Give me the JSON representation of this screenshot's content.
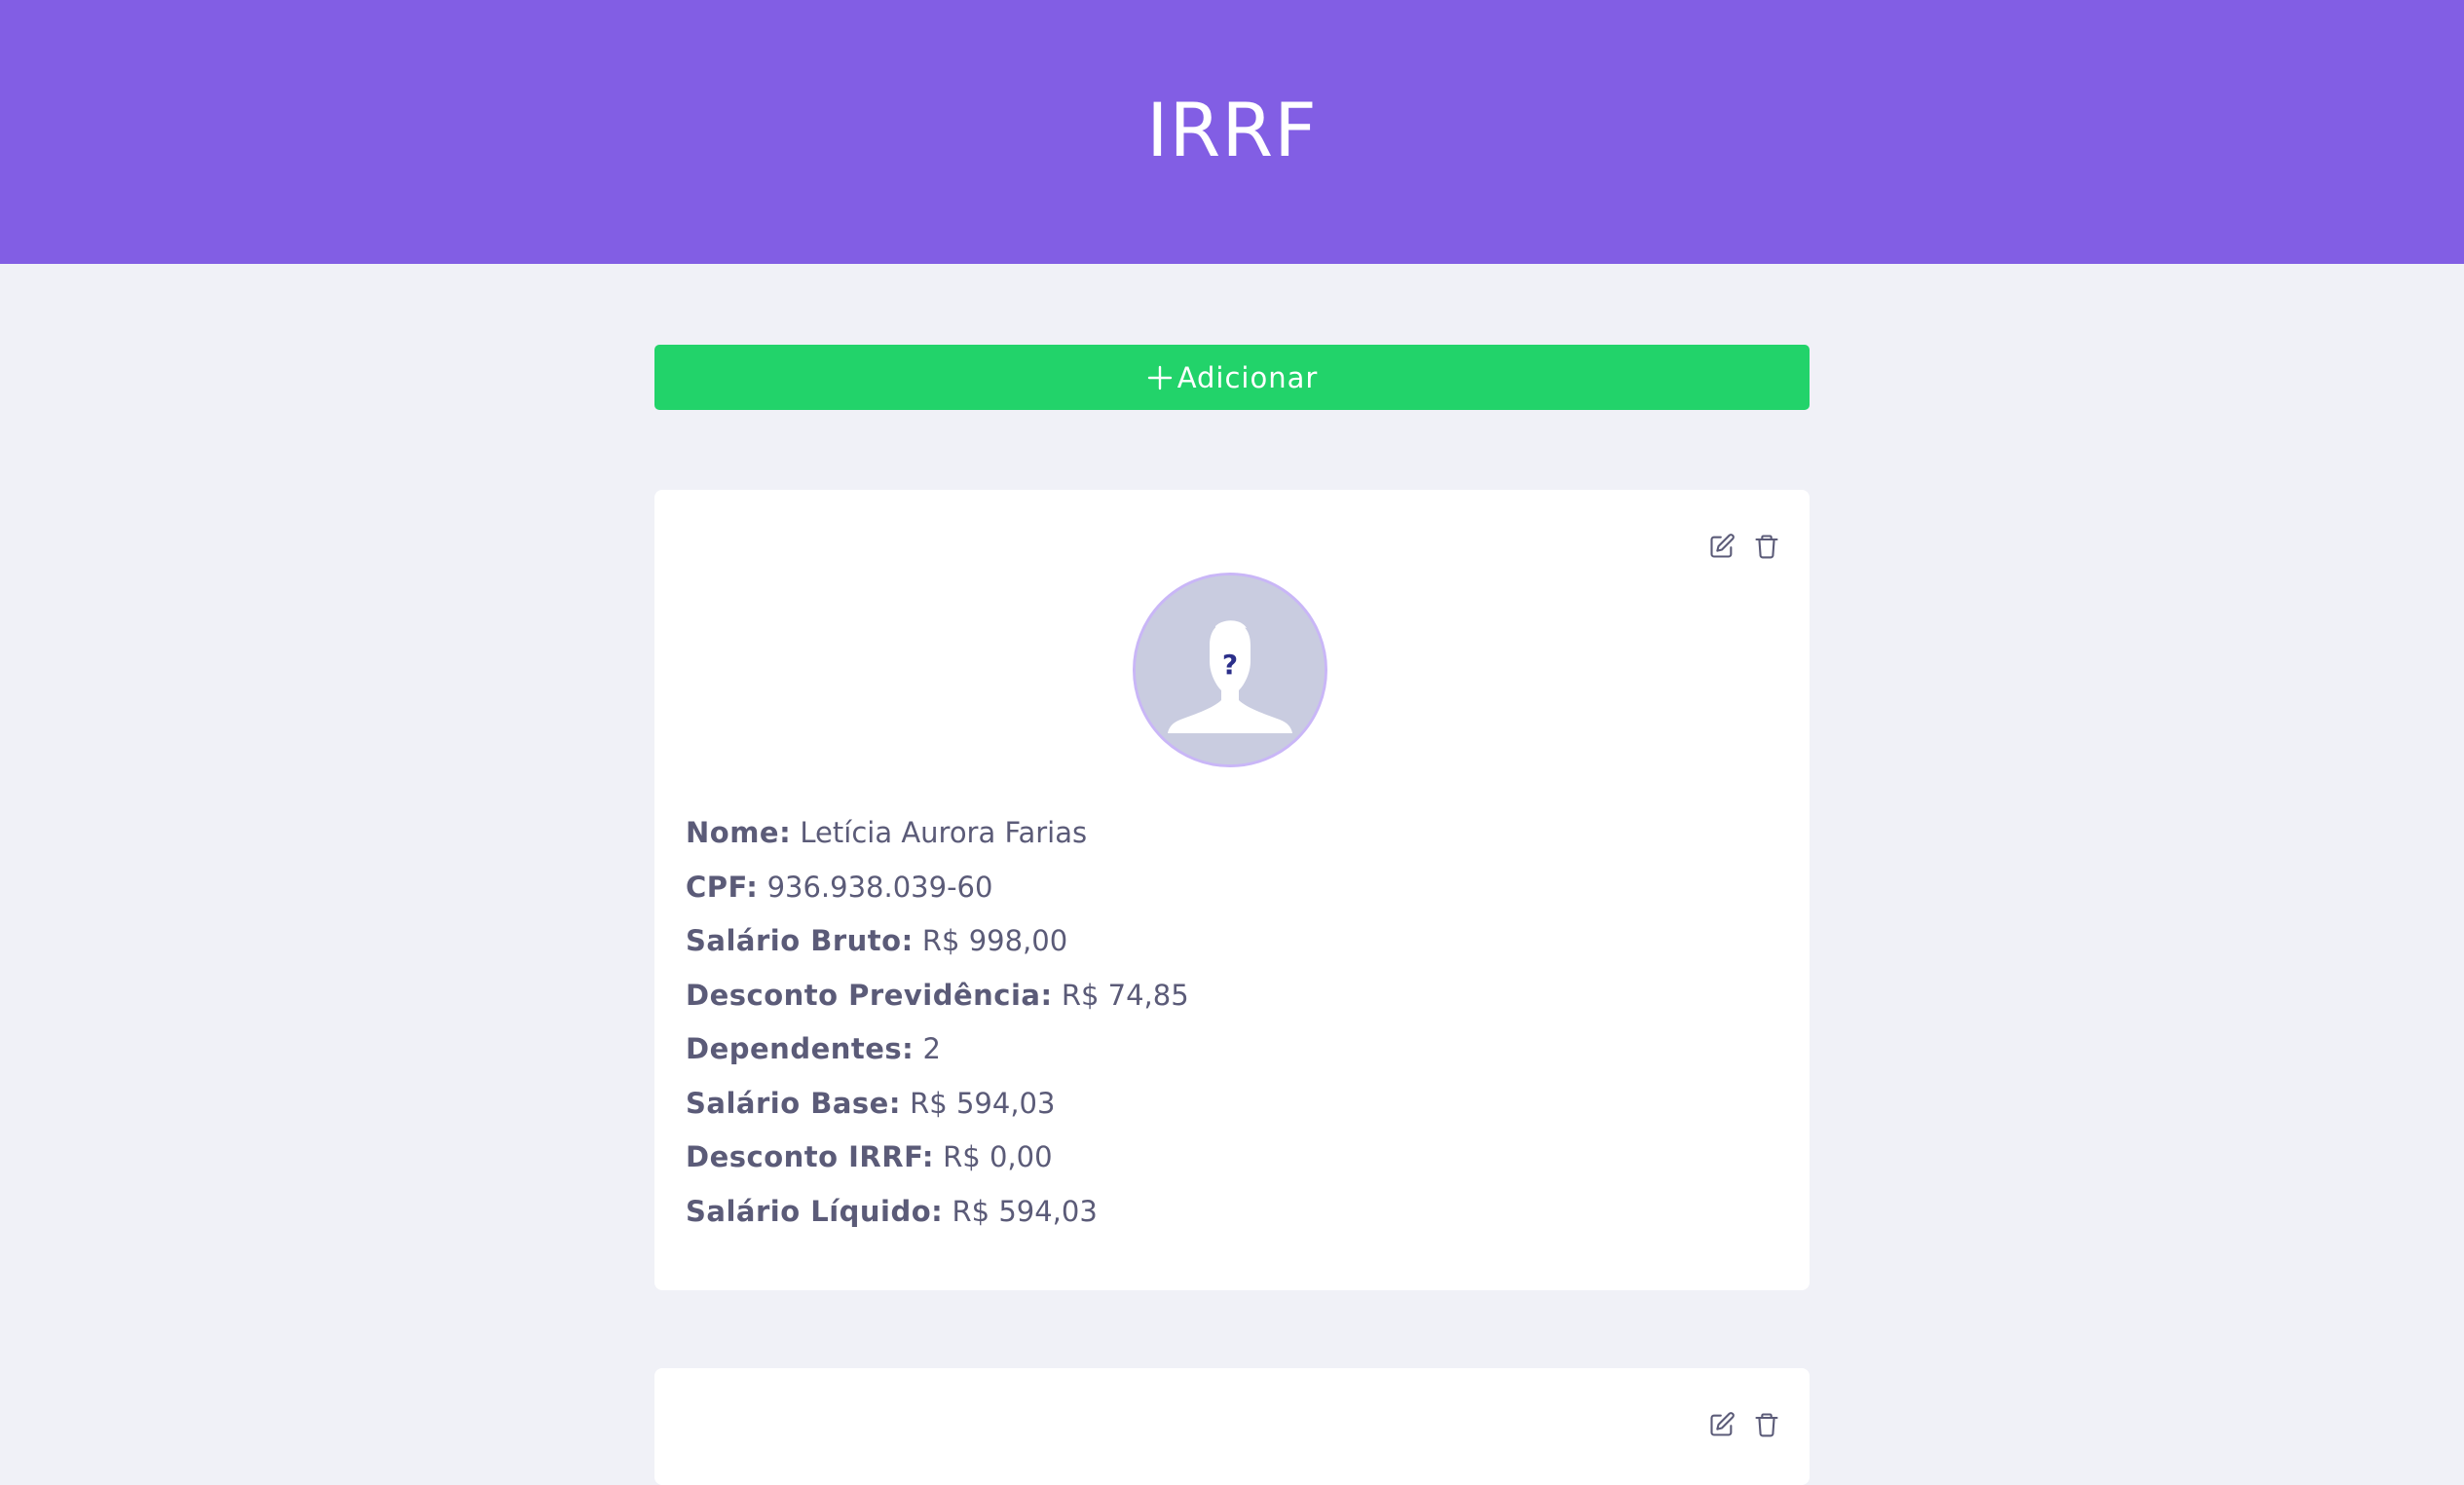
{
  "header": {
    "title": "IRRF"
  },
  "toolbar": {
    "add_label": "Adicionar",
    "add_icon": "plus-icon"
  },
  "colors": {
    "header_bg": "#825ee4",
    "add_button_bg": "#22d36a",
    "page_bg": "#f0f1f7",
    "card_bg": "#ffffff",
    "text": "#5b5b78",
    "avatar_border": "#c9b6f7"
  },
  "cards": [
    {
      "actions": [
        "edit-icon",
        "trash-icon"
      ],
      "avatar_icon": "unknown-person-icon",
      "fields": [
        {
          "label": "Nome:",
          "value": "Letícia Aurora Farias"
        },
        {
          "label": "CPF:",
          "value": "936.938.039-60"
        },
        {
          "label": "Salário Bruto:",
          "value": "R$ 998,00"
        },
        {
          "label": "Desconto Previdência:",
          "value": "R$ 74,85"
        },
        {
          "label": "Dependentes:",
          "value": "2"
        },
        {
          "label": "Salário Base:",
          "value": "R$ 594,03"
        },
        {
          "label": "Desconto IRRF:",
          "value": "R$ 0,00"
        },
        {
          "label": "Salário Líquido:",
          "value": "R$ 594,03"
        }
      ]
    },
    {
      "actions": [
        "edit-icon",
        "trash-icon"
      ]
    }
  ]
}
